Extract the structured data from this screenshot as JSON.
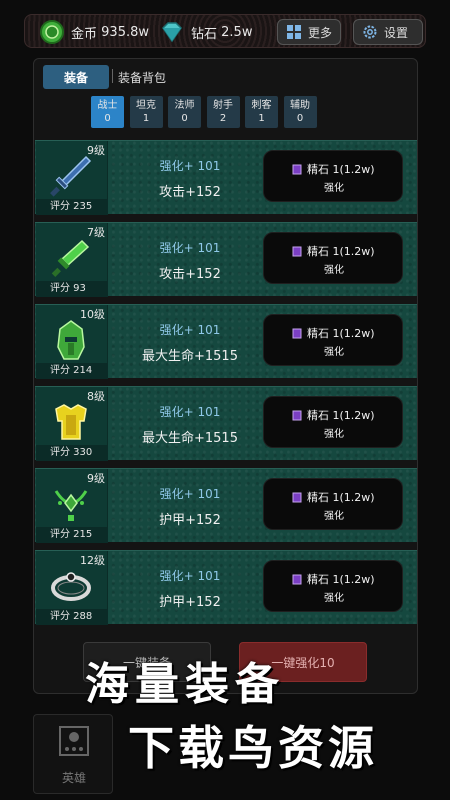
{
  "header": {
    "gold": {
      "label": "金币",
      "value": "935.8w"
    },
    "diamond": {
      "label": "钻石",
      "value": "2.5w"
    },
    "more_label": "更多",
    "settings_label": "设置"
  },
  "tabs": {
    "active": "装备",
    "inactive": "装备背包"
  },
  "classes": [
    {
      "name": "战士",
      "count": "0",
      "active": true
    },
    {
      "name": "坦克",
      "count": "1",
      "active": false
    },
    {
      "name": "法师",
      "count": "0",
      "active": false
    },
    {
      "name": "射手",
      "count": "2",
      "active": false
    },
    {
      "name": "刺客",
      "count": "1",
      "active": false
    },
    {
      "name": "辅助",
      "count": "0",
      "active": false
    }
  ],
  "items": [
    {
      "level": "9级",
      "score": "评分 235",
      "enhance": "强化+ 101",
      "stat": "攻击+152",
      "cost": "精石 1(1.2w)",
      "action": "强化",
      "art": "sword-icon"
    },
    {
      "level": "7级",
      "score": "评分 93",
      "enhance": "强化+ 101",
      "stat": "攻击+152",
      "cost": "精石 1(1.2w)",
      "action": "强化",
      "art": "dagger-icon"
    },
    {
      "level": "10级",
      "score": "评分 214",
      "enhance": "强化+ 101",
      "stat": "最大生命+1515",
      "cost": "精石 1(1.2w)",
      "action": "强化",
      "art": "helmet-icon"
    },
    {
      "level": "8级",
      "score": "评分 330",
      "enhance": "强化+ 101",
      "stat": "最大生命+1515",
      "cost": "精石 1(1.2w)",
      "action": "强化",
      "art": "armor-icon"
    },
    {
      "level": "9级",
      "score": "评分 215",
      "enhance": "强化+ 101",
      "stat": "护甲+152",
      "cost": "精石 1(1.2w)",
      "action": "强化",
      "art": "amulet-icon"
    },
    {
      "level": "12级",
      "score": "评分 288",
      "enhance": "强化+ 101",
      "stat": "护甲+152",
      "cost": "精石 1(1.2w)",
      "action": "强化",
      "art": "ring-icon"
    }
  ],
  "bottom": {
    "equip_all": "一键装备",
    "enhance_all": "一键强化10"
  },
  "nav": {
    "label": "英雄"
  },
  "watermark": {
    "line1": "海量装备",
    "line2": "下载鸟资源"
  },
  "colors": {
    "accent": "#2c84c8",
    "row_bg": "#15483f",
    "enhance_text": "#8fc8e8",
    "gem": "#7b3fc4"
  }
}
